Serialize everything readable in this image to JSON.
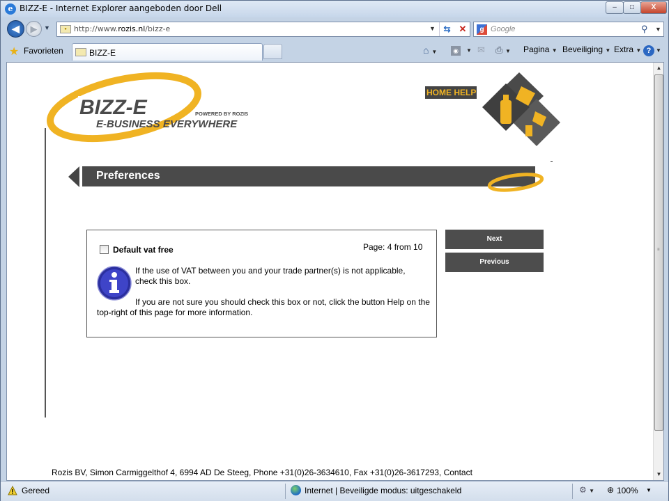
{
  "window": {
    "title": "BIZZ-E - Internet Explorer aangeboden door Dell",
    "minimize": "–",
    "maximize": "□",
    "close": "X"
  },
  "nav": {
    "back": "◀",
    "forward": "▶",
    "address_prefix": "http://www.",
    "address_domain": "rozis.nl",
    "address_path": "/bizz-e",
    "search_placeholder": "Google",
    "search_engine_letter": "g"
  },
  "commandbar": {
    "favorites": "Favorieten",
    "tab_title": "BIZZ-E",
    "pagina": "Pagina",
    "beveiliging": "Beveiliging",
    "extra": "Extra",
    "help": "?"
  },
  "page": {
    "logo_text": "BIZZ-E",
    "logo_tagline": "E-BUSINESS EVERYWHERE",
    "logo_powered": "POWERED BY ROZIS",
    "home_help": "HOME HELP",
    "section_title": "Preferences",
    "checkbox_label": "Default vat free",
    "page_indicator": "Page: 4 from 10",
    "info_paragraph_1": "If the use of VAT between you and your trade partner(s) is not applicable, check this box.",
    "info_paragraph_2": "If you are not sure you should check this box or not, click the button Help on the top-right of this page for more information.",
    "next_button": "Next",
    "previous_button": "Previous",
    "footer": "Rozis BV, Simon Carmiggelthof 4, 6994 AD De Steeg, Phone +31(0)26-3634610, Fax +31(0)26-3617293, Contact"
  },
  "statusbar": {
    "status": "Gereed",
    "zone": "Internet | Beveiligde modus: uitgeschakeld",
    "zoom": "100%"
  },
  "colors": {
    "brand_yellow": "#f0b323",
    "bar_gray": "#4a4a4a",
    "button_gray": "#4d4d4d"
  }
}
